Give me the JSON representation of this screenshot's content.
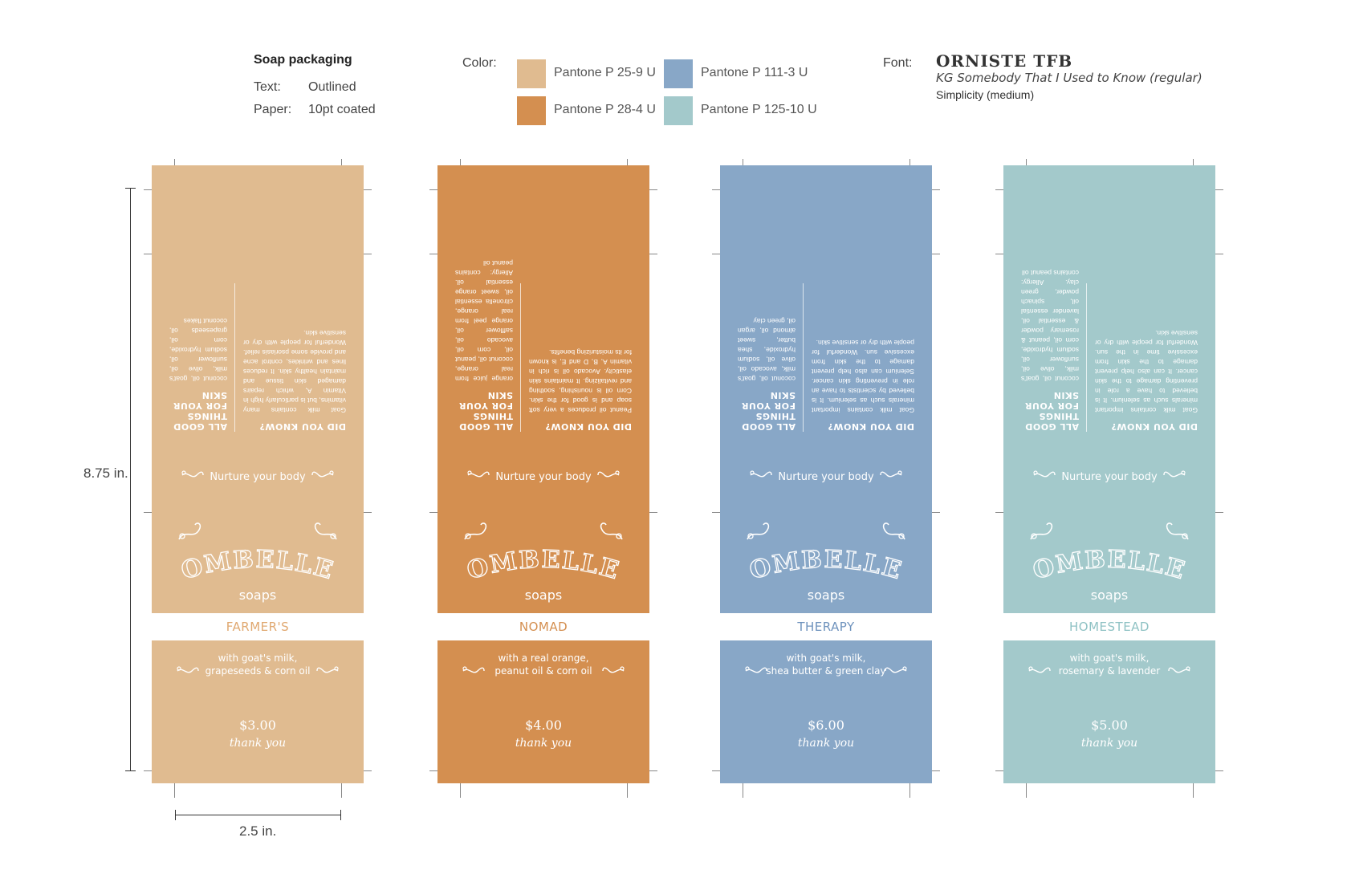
{
  "spec": {
    "title": "Soap packaging",
    "text_label": "Text:",
    "text_value": "Outlined",
    "paper_label": "Paper:",
    "paper_value": "10pt coated"
  },
  "colors": {
    "label": "Color:",
    "swatches": [
      {
        "name": "Pantone P 25-9 U",
        "hex": "#e0bb90"
      },
      {
        "name": "Pantone P 28-4 U",
        "hex": "#d48f50"
      },
      {
        "name": "Pantone P 111-3 U",
        "hex": "#88a7c7"
      },
      {
        "name": "Pantone P 125-10 U",
        "hex": "#a3c9cb"
      }
    ]
  },
  "fonts": {
    "label": "Font:",
    "list": [
      "ORNISTE TFB",
      "KG Somebody That I Used to Know (regular)",
      "Simplicity (medium)"
    ]
  },
  "dimensions": {
    "height": "8.75 in.",
    "width": "2.5 in."
  },
  "common": {
    "did_you_know": "DID YOU KNOW?",
    "all_good": "ALL GOOD THINGS FOR YOUR SKIN",
    "tagline": "Nurture your body",
    "brand": "OMBELLE",
    "brand_sub": "soaps",
    "thanks": "thank you"
  },
  "packages": [
    {
      "name": "FARMER'S",
      "color": "#e0bb90",
      "name_color": "#e0a870",
      "ingredients_line1": "with goat's milk,",
      "ingredients_line2": "grapeseeds & corn oil",
      "price": "$3.00",
      "fact": "Goat milk contains many vitamins, but is particularly high in Vitamin A, which repairs damaged skin tissue and maintain healthy skin. It reduces lines and wrinkles, control acne and provide some psoriasis relief. Wonderful for people with dry or sensitive skin.",
      "ingredients_list": "coconut oil, goat's milk, olive oil, sunflower oil, sodium hydroxide, corn oil, grapeseeds oil, coconut flakes"
    },
    {
      "name": "NOMAD",
      "color": "#d48f50",
      "name_color": "#d48f50",
      "ingredients_line1": "with a real orange,",
      "ingredients_line2": "peanut oil & corn oil",
      "price": "$4.00",
      "fact": "Peanut oil produces a very soft soap and is good for the skin. Corn oil is nourishing, soothing and revitalizing. It maintains skin elasticity. Avocado oil is rich in vitamin A, B, D and E, is known for its moisturizing benefits.",
      "ingredients_list": "orange juice from real orange, coconut oil, peanut oil, corn oil, avocado oil, safflower oil, orange peel from real orange, citronella essential oil, sweet orange essential oil. Allergy: contains peanut oil"
    },
    {
      "name": "THERAPY",
      "color": "#88a7c7",
      "name_color": "#6f93bd",
      "ingredients_line1": "with goat's milk,",
      "ingredients_line2": "shea butter & green clay",
      "price": "$6.00",
      "fact": "Goat milk contains important minerals such as selenium. It is believed by scientists to have an role in preventing skin cancer. Selenium can also help prevent damage to the skin from excessive sun. Wonderful for people with dry or sensitive skin.",
      "ingredients_list": "coconut oil, goat's milk, avocado oil, olive oil, sodium hydroxide, shea butter, sweet almond oil, argan oil, green clay"
    },
    {
      "name": "HOMESTEAD",
      "color": "#a3c9cb",
      "name_color": "#8fc2c4",
      "ingredients_line1": "with goat's milk,",
      "ingredients_line2": "rosemary & lavender",
      "price": "$5.00",
      "fact": "Goat milk contains important minerals such as selenium. It is believed to have a role in preventing damage to the skin cancer. It can also help prevent damage to the skin from excessive time in the sun. Wonderful for people with dry or sensitive skin.",
      "ingredients_list": "coconut oil, goat's milk, olive oil, sunflower oil, sodium hydroxide, corn oil, peanut & rosemary powder & essential oil, lavender essential oil, spinach powder, green clay. Allergy: contains peanut oil"
    }
  ]
}
